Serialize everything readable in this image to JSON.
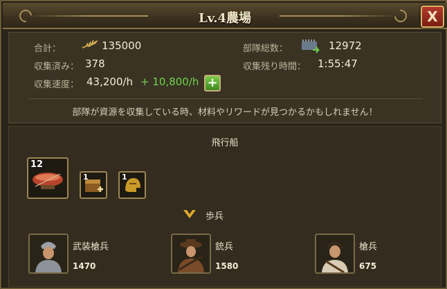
{
  "window": {
    "title": "Lv.4農場",
    "close_label": "X"
  },
  "stats": {
    "total_label": "合計：",
    "total_value": "135000",
    "collected_label": "収集済み：",
    "collected_value": "378",
    "speed_label": "収集速度：",
    "speed_value": "43,200/h",
    "speed_bonus": "+ 10,800/h",
    "troops_label": "部隊総数：",
    "troops_value": "12972",
    "remaining_label": "収集残り時間：",
    "remaining_value": "1:55:47",
    "plus_label": "+"
  },
  "notice": "部隊が資源を収集している時、材料やリワードが見つかるかもしれません！",
  "airship": {
    "heading": "飛行船",
    "ship_count": "12",
    "item1_count": "1",
    "item2_count": "1"
  },
  "infantry": {
    "heading": "歩兵",
    "units": [
      {
        "name": "武装槍兵",
        "count": "1470"
      },
      {
        "name": "銃兵",
        "count": "1580"
      },
      {
        "name": "槍兵",
        "count": "675"
      }
    ]
  },
  "colors": {
    "accent_green": "#6fd34a",
    "close_red": "#b23a2a",
    "frame_gold": "#9c8652"
  }
}
